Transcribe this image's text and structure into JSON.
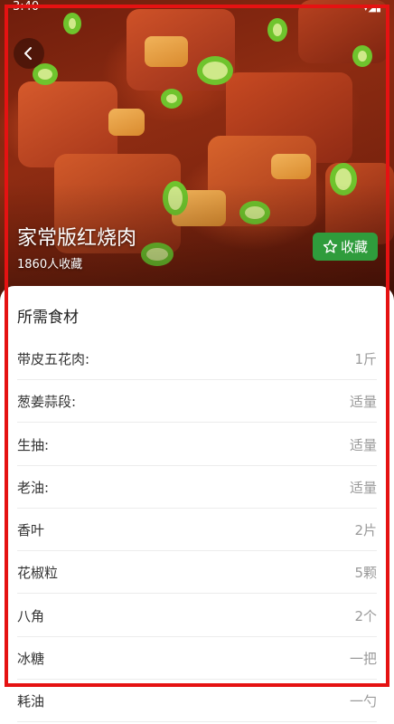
{
  "status_bar": {
    "time": "3:40",
    "icons": "▾◢▮"
  },
  "hero": {
    "title": "家常版红烧肉",
    "favorites": "1860人收藏",
    "back_icon": "chevron-left-icon",
    "favorite_button": {
      "label": "收藏",
      "icon": "star-outline-icon",
      "color": "#2f9c3c"
    }
  },
  "ingredients": {
    "title": "所需食材",
    "items": [
      {
        "name": "带皮五花肉:",
        "amount": "1斤"
      },
      {
        "name": "葱姜蒜段:",
        "amount": "适量"
      },
      {
        "name": "生抽:",
        "amount": "适量"
      },
      {
        "name": "老油:",
        "amount": "适量"
      },
      {
        "name": "香叶",
        "amount": "2片"
      },
      {
        "name": "花椒粒",
        "amount": "5颗"
      },
      {
        "name": "八角",
        "amount": "2个"
      },
      {
        "name": "冰糖",
        "amount": "一把"
      },
      {
        "name": "耗油",
        "amount": "一勺"
      }
    ]
  },
  "frame_color": "#e51212"
}
